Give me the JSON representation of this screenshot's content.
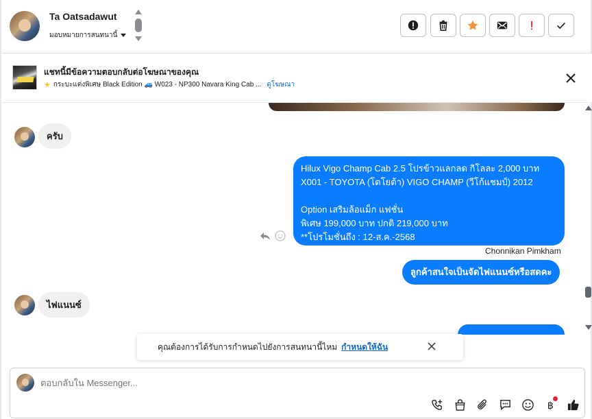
{
  "header": {
    "contact_name": "Ta Oatsadawut",
    "assign_label": "มอบหมายการสนทนานี้",
    "buttons": [
      {
        "name": "mark-spam-button",
        "icon": "alert-circle-icon"
      },
      {
        "name": "delete-button",
        "icon": "trash-icon"
      },
      {
        "name": "star-button",
        "icon": "star-icon",
        "color": "#f7923a"
      },
      {
        "name": "mark-unread-button",
        "icon": "envelope-icon"
      },
      {
        "name": "follow-up-button",
        "icon": "exclamation-icon",
        "color": "#e41e3f"
      },
      {
        "name": "mark-done-button",
        "icon": "checkmark-icon"
      }
    ]
  },
  "ad_banner": {
    "title": "แชทนี้มีข้อความตอบกลับต่อโฆษณาของคุณ",
    "subtitle": "กระบะแต่งพิเศษ Black Edition 🚙 W023 - NP300 Navara King Cab ...",
    "link_label": "ดูโฆษณา"
  },
  "messages": [
    {
      "direction": "in",
      "text": "ครับ"
    },
    {
      "direction": "out",
      "text": "Hilux Vigo Champ Cab 2.5 โปรข้าวแลกลด กิโลละ 2,000 บาท\nX001 - TOYOTA (โตโยต้า) VIGO CHAMP (วีโก้แชมป์) 2012\n\n Option เสริมล้อแม็ก แฟชั่น\nพิเศษ 199,000 บาท  ปกติ 219,000 บาท\n**โปรโมชั่นถึง : 12-ส.ค.-2568"
    },
    {
      "direction": "out",
      "sender": "Chonnikan Pimkham",
      "text": "ลูกค้าสนใจเป็นจัดไฟแนนซ์หรือสดคะ"
    },
    {
      "direction": "in",
      "text": "ไฟแนนซ์"
    }
  ],
  "notice": {
    "text": "คุณต้องการได้รับการกำหนดไปยังการสนทนานี้ไหม",
    "link_label": "กำหนดให้ฉัน"
  },
  "composer": {
    "placeholder": "ตอบกลับใน Messenger..."
  },
  "colors": {
    "accent": "#0a7cff",
    "link": "#1566c0",
    "alert": "#e41e3f",
    "star": "#f7923a"
  }
}
